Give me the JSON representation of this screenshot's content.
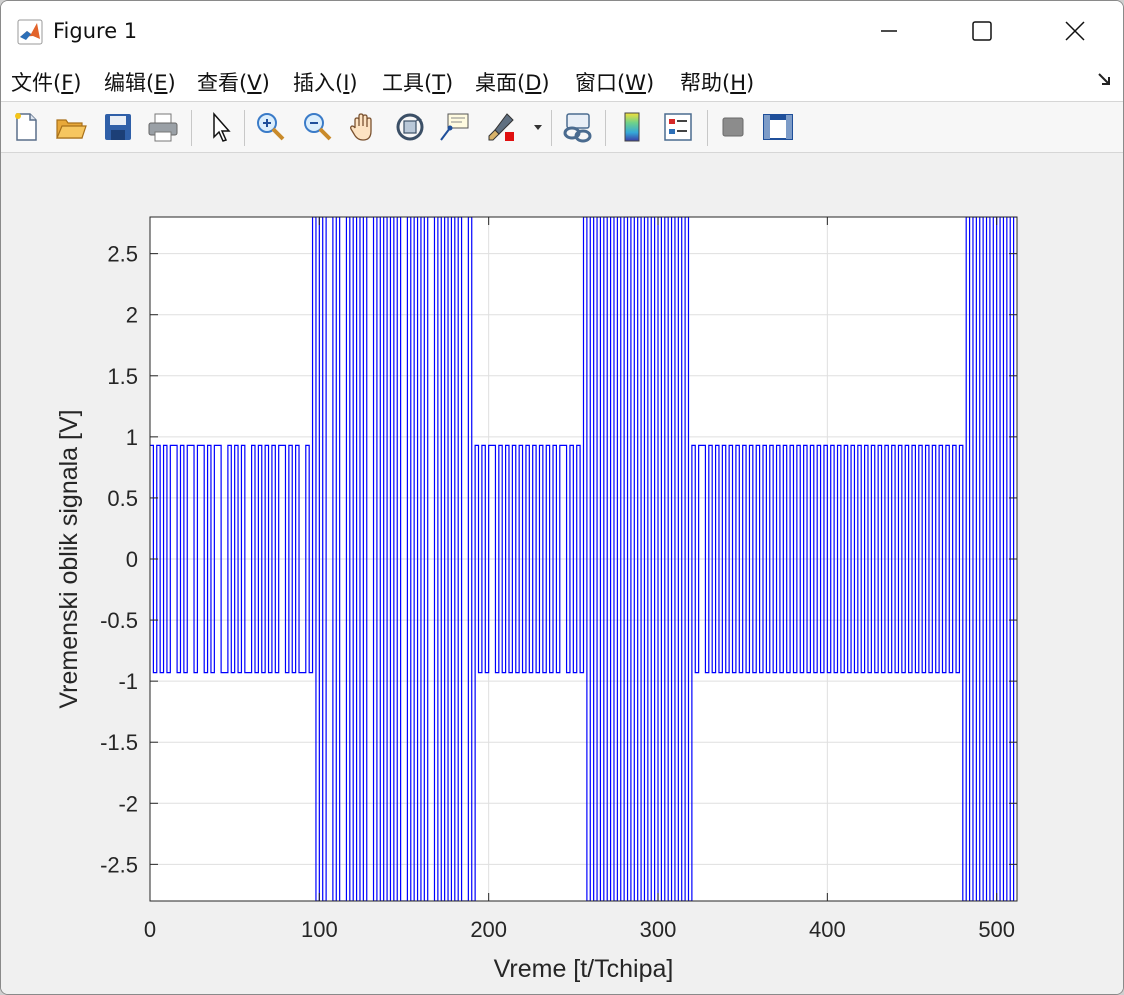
{
  "window": {
    "title": "Figure 1",
    "icon": "matlab-logo-icon",
    "controls": [
      "minimize-icon",
      "maximize-icon",
      "close-icon"
    ]
  },
  "menu": {
    "items": [
      {
        "label": "文件(",
        "accel": "F",
        "tail": ")"
      },
      {
        "label": "编辑(",
        "accel": "E",
        "tail": ")"
      },
      {
        "label": "查看(",
        "accel": "V",
        "tail": ")"
      },
      {
        "label": "插入(",
        "accel": "I",
        "tail": ")"
      },
      {
        "label": "工具(",
        "accel": "T",
        "tail": ")"
      },
      {
        "label": "桌面(",
        "accel": "D",
        "tail": ")"
      },
      {
        "label": "窗口(",
        "accel": "W",
        "tail": ")"
      },
      {
        "label": "帮助(",
        "accel": "H",
        "tail": ")"
      }
    ],
    "corner_icon": "dock-arrow-icon"
  },
  "toolbar": {
    "icons": [
      "new-figure-icon",
      "open-file-icon",
      "save-icon",
      "print-icon",
      "edit-plot-icon",
      "zoom-in-icon",
      "zoom-out-icon",
      "pan-icon",
      "rotate-3d-icon",
      "data-cursor-icon",
      "brush-icon",
      "link-plot-icon",
      "colorbar-icon",
      "legend-icon",
      "hide-plot-tools-icon",
      "show-plot-tools-icon"
    ]
  },
  "chart_data": {
    "type": "line",
    "xlabel": "Vreme [t/Tchipa]",
    "ylabel": "Vremenski oblik signala [V]",
    "xlim": [
      0,
      512
    ],
    "ylim": [
      -2.8,
      2.8
    ],
    "xticks": [
      0,
      100,
      200,
      300,
      400,
      500
    ],
    "xtick_labels": [
      "0",
      "100",
      "200",
      "300",
      "400",
      "500"
    ],
    "yticks": [
      2.5,
      2,
      1.5,
      1,
      0.5,
      0,
      -0.5,
      -1,
      -1.5,
      -2,
      -2.5
    ],
    "ytick_labels": [
      "2.5",
      "2",
      "1.5",
      "1",
      "0.5",
      "0",
      "-0.5",
      "-1",
      "-1.5",
      "-2",
      "-2.5"
    ],
    "grid": true,
    "line_color": "#0000ff",
    "segments": [
      {
        "x_start": 0,
        "x_end": 96,
        "amplitude": 0.93
      },
      {
        "x_start": 96,
        "x_end": 192,
        "amplitude": 2.8
      },
      {
        "x_start": 192,
        "x_end": 256,
        "amplitude": 0.93
      },
      {
        "x_start": 256,
        "x_end": 320,
        "amplitude": 2.8
      },
      {
        "x_start": 320,
        "x_end": 480,
        "amplitude": 0.93
      },
      {
        "x_start": 480,
        "x_end": 512,
        "amplitude": 2.8
      }
    ],
    "chip_period": 2,
    "chip_sequence": "+-+-+-++-+-++-++-+-++--+-+-+--+-+-+-+-++-+-+--+-+-+-++-+--+-+-+-++-+-+-+-+--+-+-+-++-+-+-+-+--+-+-+-++-+-+-+-+-+-+-+-+-+-++-+-+-+-+-+-+-+-+-+-+-+-+-+-+-+-+-+-+-+-++-+-+-+-+-+-+-+-+-+-+-+-+-+-+-+-+-+-+-+-+-+-+-+-+-+-+-+-+-+-+-+-+-+-+-+-+-+-+-+-+-+-+-+-+-+-+-+-"
  }
}
